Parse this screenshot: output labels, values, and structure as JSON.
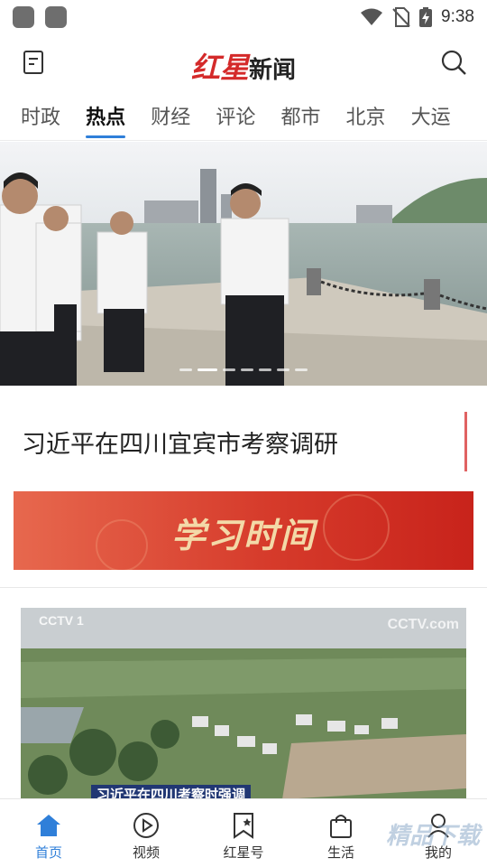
{
  "status_bar": {
    "time": "9:38"
  },
  "header": {
    "logo_red": "红星",
    "logo_black": "新闻"
  },
  "tabs": [
    "时政",
    "热点",
    "财经",
    "评论",
    "都市",
    "北京",
    "大运"
  ],
  "active_tab": "热点",
  "banner": {
    "headline": "习近平在四川宜宾市考察调研",
    "slide_count": 7,
    "active_slide": 1
  },
  "study_banner": {
    "text": "学习时间"
  },
  "video": {
    "cctv_logo": "CCTV 1",
    "cctv_logo_right": "CCTV.com",
    "caption": "习近平在四川考察时强调"
  },
  "bottom_nav": [
    {
      "label": "首页",
      "icon": "home-icon"
    },
    {
      "label": "视频",
      "icon": "play-icon"
    },
    {
      "label": "红星号",
      "icon": "bookmark-star-icon"
    },
    {
      "label": "生活",
      "icon": "shopping-bag-icon"
    },
    {
      "label": "我的",
      "icon": "profile-icon"
    }
  ],
  "active_nav": "首页",
  "watermark": "精品下载",
  "colors": {
    "accent": "#2f7fd9",
    "brand_red": "#d42a2a",
    "study_red": "#d63b2b"
  }
}
